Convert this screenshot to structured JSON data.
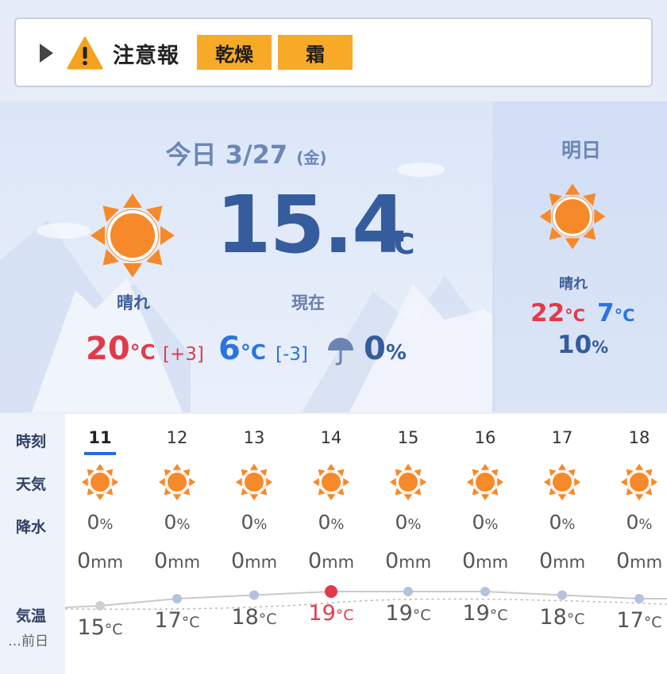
{
  "warning": {
    "label": "注意報",
    "tags": [
      "乾燥",
      "霜"
    ],
    "colors": {
      "tag_bg": "#f7a928",
      "triangle": "#f6a21e"
    }
  },
  "today": {
    "date": "今日 3/27",
    "weekday": "(金)",
    "condition": "晴れ",
    "icon": "sun-icon",
    "current_temp": "15.4",
    "current_unit": "°C",
    "current_label": "現在",
    "high": "20",
    "high_diff": "[+3]",
    "low": "6",
    "low_diff": "[-3]",
    "rain_prob": "0",
    "unit_c": "°C",
    "unit_pct": "%"
  },
  "tomorrow": {
    "title": "明日",
    "condition": "晴れ",
    "icon": "sun-icon",
    "high": "22",
    "low": "7",
    "rain_prob": "10",
    "unit_c": "°C",
    "unit_pct": "%"
  },
  "hourly": {
    "labels": {
      "time": "時刻",
      "weather": "天気",
      "rain": "降水",
      "temp": "気温",
      "prev_day": "…前日"
    },
    "hours": [
      {
        "hour": "11",
        "rain": "0",
        "mm": "0",
        "temp": "15",
        "current": true
      },
      {
        "hour": "12",
        "rain": "0",
        "mm": "0",
        "temp": "17"
      },
      {
        "hour": "13",
        "rain": "0",
        "mm": "0",
        "temp": "18"
      },
      {
        "hour": "14",
        "rain": "0",
        "mm": "0",
        "temp": "19",
        "max": true
      },
      {
        "hour": "15",
        "rain": "0",
        "mm": "0",
        "temp": "19"
      },
      {
        "hour": "16",
        "rain": "0",
        "mm": "0",
        "temp": "19"
      },
      {
        "hour": "17",
        "rain": "0",
        "mm": "0",
        "temp": "18"
      },
      {
        "hour": "18",
        "rain": "0",
        "mm": "0",
        "temp": "17"
      }
    ],
    "units": {
      "pct": "%",
      "mm": "mm",
      "c": "°C"
    },
    "colors": {
      "high": "#e23a4a",
      "point": "#b4c3dc",
      "underline": "#1e6fe0"
    }
  }
}
